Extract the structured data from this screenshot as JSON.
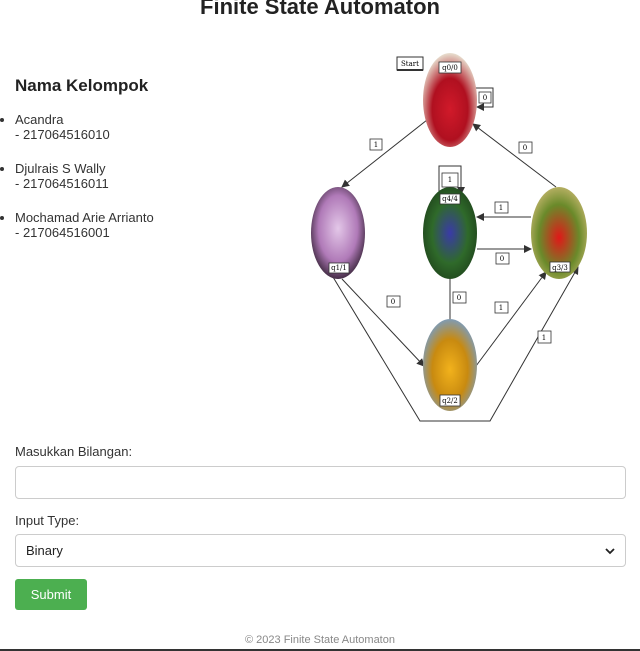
{
  "page": {
    "title": "Finite State Automaton"
  },
  "group": {
    "heading": "Nama Kelompok",
    "members": [
      {
        "name": "Acandra",
        "nim": "- 217064516010"
      },
      {
        "name": "Djulrais S Wally",
        "nim": "- 217064516011"
      },
      {
        "name": "Mochamad Arie Arrianto",
        "nim": "- 217064516001"
      }
    ]
  },
  "diagram": {
    "start_label": "Start",
    "states": {
      "q0": {
        "label": "q0/0",
        "image": "red-roses"
      },
      "q1": {
        "label": "q1/1",
        "image": "pink-orchids"
      },
      "q2": {
        "label": "q2/2",
        "image": "sunflowers"
      },
      "q3": {
        "label": "q3/3",
        "image": "red-spider-lilies"
      },
      "q4": {
        "label": "q4/4",
        "image": "blue-morning-glory"
      }
    },
    "transitions": {
      "q0_to_q1": "1",
      "q0_self": "0",
      "q3_to_q0": "0",
      "q4_self": "1",
      "q3_to_q4": "1",
      "q4_to_q3": "0",
      "q1_to_q2": "0",
      "q2_to_q4": "0",
      "q2_to_q3": "1",
      "q1_to_q3": "1"
    }
  },
  "form": {
    "number_label": "Masukkan Bilangan:",
    "number_value": "",
    "type_label": "Input Type:",
    "type_selected": "Binary",
    "submit_label": "Submit"
  },
  "footer": {
    "text": "© 2023 Finite State Automaton"
  },
  "colors": {
    "submit_bg": "#4caf50",
    "edge": "#333333"
  }
}
